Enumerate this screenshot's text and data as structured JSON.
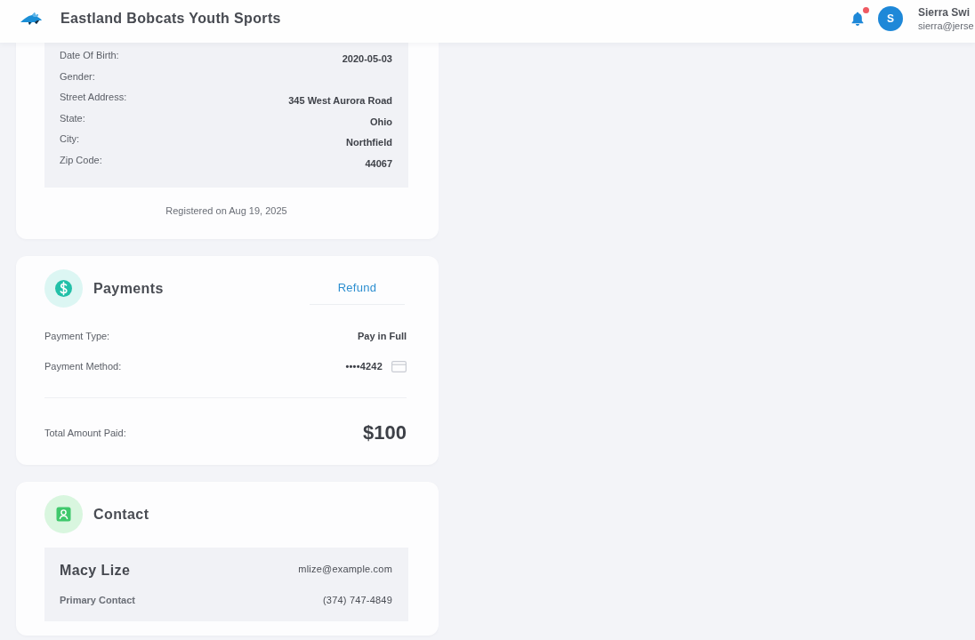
{
  "header": {
    "title": "Eastland Bobcats Youth Sports",
    "notifications": {
      "unread": true
    },
    "user": {
      "initial": "S",
      "name": "Sierra Swi",
      "email": "sierra@jerse"
    }
  },
  "registration": {
    "fields": [
      {
        "label": "Date Of Birth:",
        "value": "2020-05-03"
      },
      {
        "label": "Gender:"
      },
      {
        "label": "Street Address:",
        "value": "345 West Aurora Road"
      },
      {
        "label": "State:",
        "value": "Ohio"
      },
      {
        "label": "City:",
        "value": "Northfield"
      },
      {
        "label": "Zip Code:",
        "value": "44067"
      }
    ],
    "footer": "Registered on Aug 19, 2025"
  },
  "payments": {
    "title": "Payments",
    "action": "Refund",
    "fields": [
      {
        "kind": "text",
        "label": "Payment Type:",
        "value": "Pay in Full"
      },
      {
        "kind": "card",
        "label": "Payment Method:",
        "value": "••••4242"
      }
    ],
    "total": {
      "label": "Total Amount Paid:",
      "value": "$100"
    }
  },
  "contact": {
    "title": "Contact",
    "contacts": [
      {
        "name": "Macy Lize",
        "email": "mlize@example.com",
        "role": "Primary Contact",
        "phone": "(374) 747-4849"
      }
    ]
  }
}
